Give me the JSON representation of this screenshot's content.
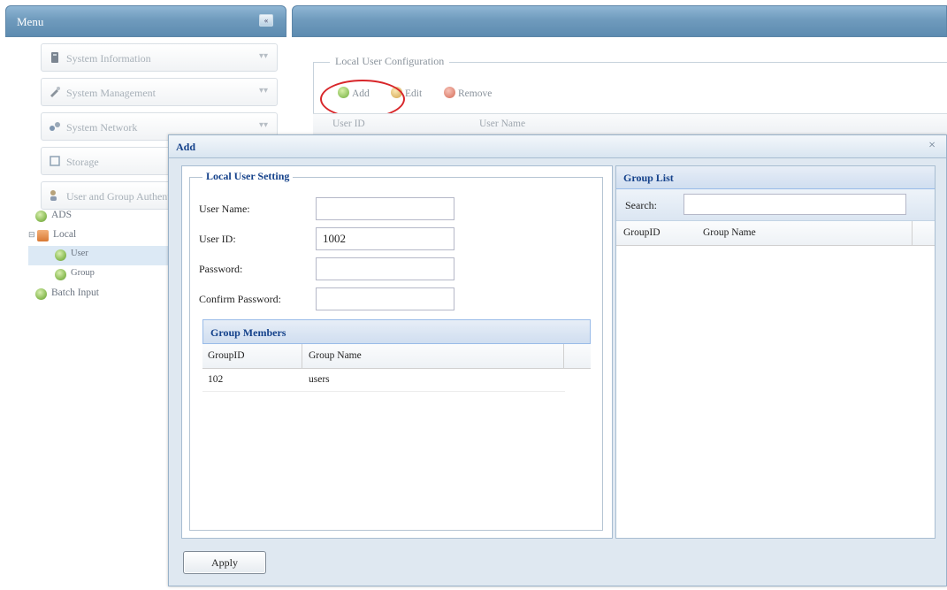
{
  "menu": {
    "title": "Menu",
    "sections": [
      {
        "label": "System Information",
        "icon": "info-icon"
      },
      {
        "label": "System Management",
        "icon": "wrench-icon"
      },
      {
        "label": "System Network",
        "icon": "network-icon"
      },
      {
        "label": "Storage",
        "icon": "storage-icon"
      },
      {
        "label": "User and Group Authentication",
        "icon": "users-icon"
      }
    ],
    "tree": [
      {
        "label": "ADS",
        "level": 0
      },
      {
        "label": "Local",
        "level": 0
      },
      {
        "label": "User",
        "level": 1,
        "selected": true
      },
      {
        "label": "Group",
        "level": 1
      },
      {
        "label": "Batch Input",
        "level": 0
      }
    ]
  },
  "main": {
    "legend": "Local User Configuration",
    "toolbar": {
      "add": "Add",
      "edit": "Edit",
      "remove": "Remove"
    },
    "columns": {
      "user_id": "User ID",
      "user_name": "User Name"
    }
  },
  "dialog": {
    "title": "Add",
    "close": "×",
    "local_user_setting": {
      "legend": "Local User Setting",
      "user_name_label": "User Name:",
      "user_name_value": "",
      "user_id_label": "User ID:",
      "user_id_value": "1002",
      "password_label": "Password:",
      "confirm_password_label": "Confirm Password:"
    },
    "group_members": {
      "title": "Group Members",
      "columns": [
        "GroupID",
        "Group Name"
      ],
      "rows": [
        {
          "group_id": "102",
          "group_name": "users"
        }
      ]
    },
    "group_list": {
      "title": "Group List",
      "search_label": "Search:",
      "search_value": "",
      "columns": [
        "GroupID",
        "Group Name"
      ]
    },
    "apply_label": "Apply"
  },
  "colors": {
    "header_blue": "#6f9bbd",
    "highlight_red": "#d8262a",
    "ext_title": "#15428b"
  }
}
